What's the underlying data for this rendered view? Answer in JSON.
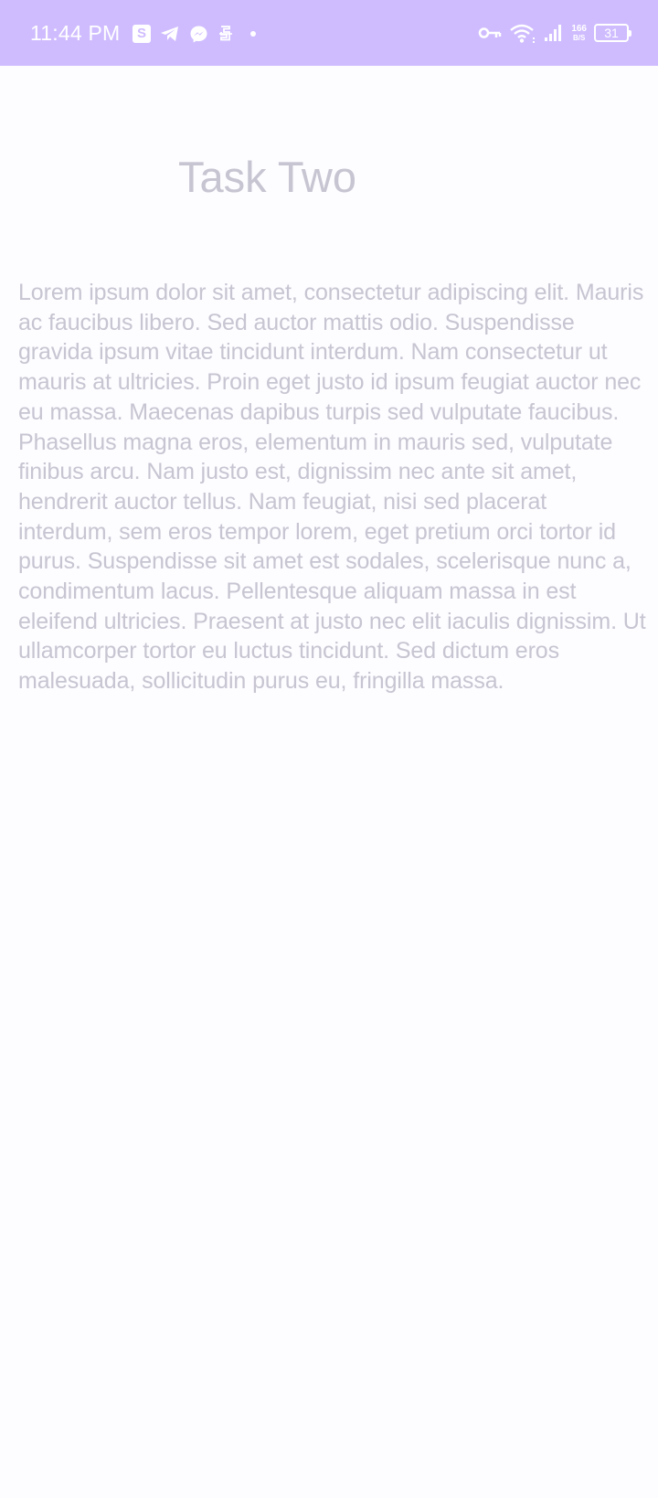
{
  "status_bar": {
    "time": "11:44 PM",
    "notification_icons": [
      "s-app-icon",
      "telegram-icon",
      "messenger-icon",
      "s-logo-icon",
      "dot-icon"
    ],
    "s_app_label": "S",
    "net_speed_value": "166",
    "net_speed_unit": "B/S",
    "battery_level": "31",
    "background_color": "#cfbcff"
  },
  "screen": {
    "title": "Task Two",
    "body": "Lorem ipsum dolor sit amet, consectetur adipiscing elit. Mauris ac faucibus libero. Sed auctor mattis odio. Suspendisse gravida ipsum vitae tincidunt interdum. Nam consectetur ut mauris at ultricies. Proin eget justo id ipsum feugiat auctor nec eu massa. Maecenas dapibus turpis sed vulputate faucibus. Phasellus magna eros, elementum in mauris sed, vulputate finibus arcu. Nam justo est, dignissim nec ante sit amet, hendrerit auctor tellus. Nam feugiat, nisi sed placerat interdum, sem eros tempor lorem, eget pretium orci tortor id purus. Suspendisse sit amet est sodales, scelerisque nunc a, condimentum lacus. Pellentesque aliquam massa in est eleifend ultricies. Praesent at justo nec elit iaculis dignissim. Ut ullamcorper tortor eu luctus tincidunt. Sed dictum eros malesuada, sollicitudin purus eu, fringilla massa.",
    "text_color": "#c6c5d1",
    "background_color": "#fdfcff"
  }
}
